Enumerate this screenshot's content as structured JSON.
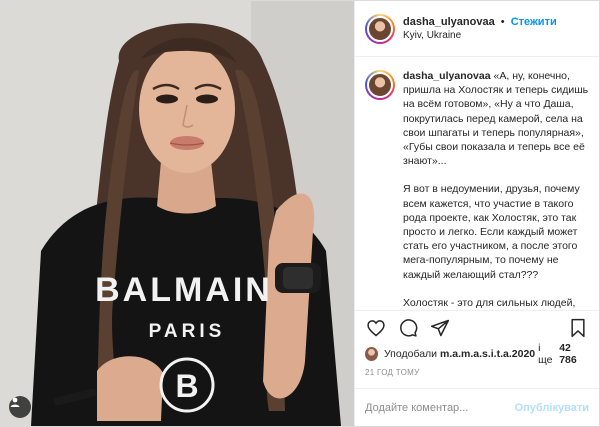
{
  "header": {
    "username": "dasha_ulyanovaa",
    "separator": "•",
    "follow_label": "Стежити",
    "location": "Kyiv, Ukraine",
    "more_icon": "more-horizontal-icon"
  },
  "caption": {
    "username": "dasha_ulyanovaa",
    "paragraphs": [
      "«А, ну, конечно, пришла на Холостяк и теперь сидишь на всём готовом», «Ну а что Даша, покрутилась перед камерой, села на свои шпагаты и теперь популярная», «Губы свои показала и теперь все её знают»...",
      "Я вот в недоумении, друзья, почему всем кажется, что участие в такого рода проекте, как Холостяк, это так просто и легко. Если каждый может стать его участником, а после этого мега-популярным, то почему не каждый желающий стал???",
      "Холостяк - это для сильных людей, готовых сквозь сложный тернистый пусть идти к своей любви. Сколько конфликтов, услесызаний"
    ]
  },
  "photo": {
    "shirt_brand": "BALMAIN",
    "shirt_city": "PARIS",
    "shirt_emblem": "B",
    "tagged_icon": "user-tag-icon"
  },
  "actions": {
    "like_icon": "heart-icon",
    "comment_icon": "comment-icon",
    "share_icon": "share-icon",
    "save_icon": "bookmark-icon"
  },
  "likes": {
    "prefix": "Уподобали",
    "user": "m.a.m.a.s.i.t.a.2020",
    "middle": "і ще",
    "count": "42 786"
  },
  "time": "21 год тому",
  "comment": {
    "placeholder": "Додайте коментар...",
    "publish_label": "Опублікувати"
  }
}
